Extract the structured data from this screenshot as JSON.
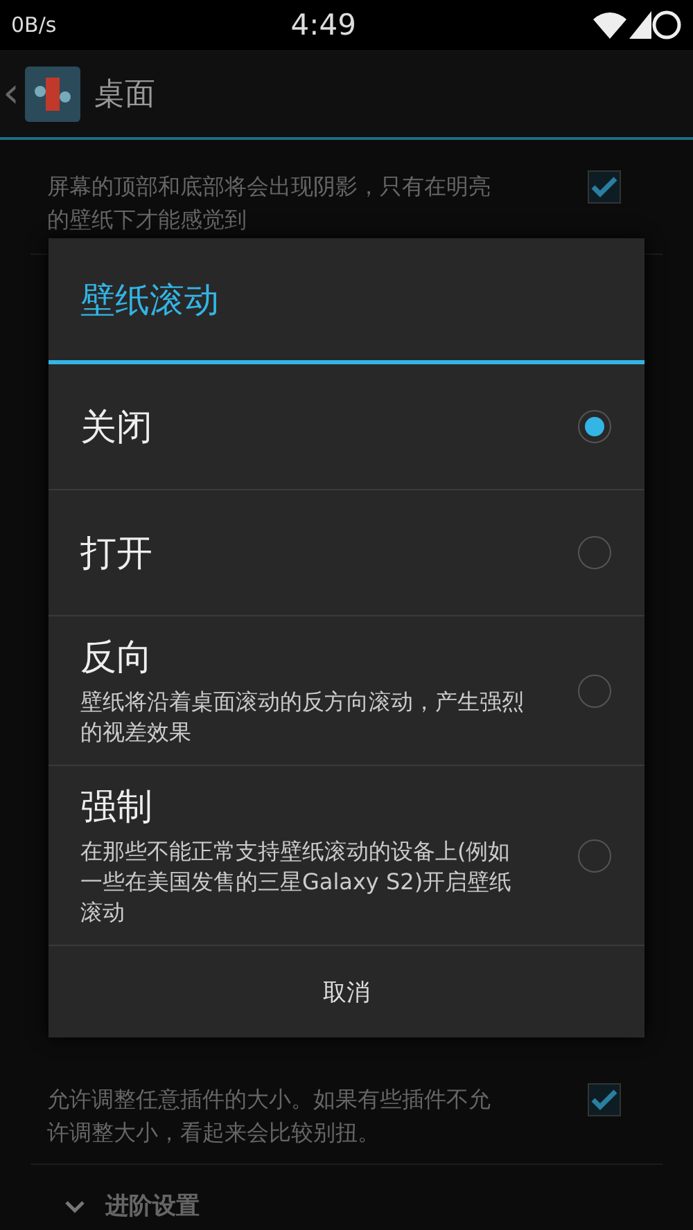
{
  "status_bar": {
    "speed": "0B/s",
    "time": "4:49"
  },
  "action_bar": {
    "back": "‹",
    "title": "桌面"
  },
  "settings": [
    {
      "description": "屏幕的顶部和底部将会出现阴影，只有在明亮的壁纸下才能感觉到",
      "checked": true
    },
    {
      "description": "允许调整任意插件的大小。如果有些插件不允许调整大小，看起来会比较别扭。",
      "checked": true
    }
  ],
  "section": {
    "label": "进阶设置",
    "expanded": false
  },
  "dialog": {
    "title": "壁纸滚动",
    "options": [
      {
        "label": "关闭",
        "selected": true
      },
      {
        "label": "打开",
        "selected": false
      },
      {
        "label": "反向",
        "description": "壁纸将沿着桌面滚动的反方向滚动，产生强烈的视差效果",
        "selected": false
      },
      {
        "label": "强制",
        "description": "在那些不能正常支持壁纸滚动的设备上(例如一些在美国发售的三星Galaxy S2)开启壁纸滚动",
        "selected": false
      }
    ],
    "cancel": "取消"
  }
}
